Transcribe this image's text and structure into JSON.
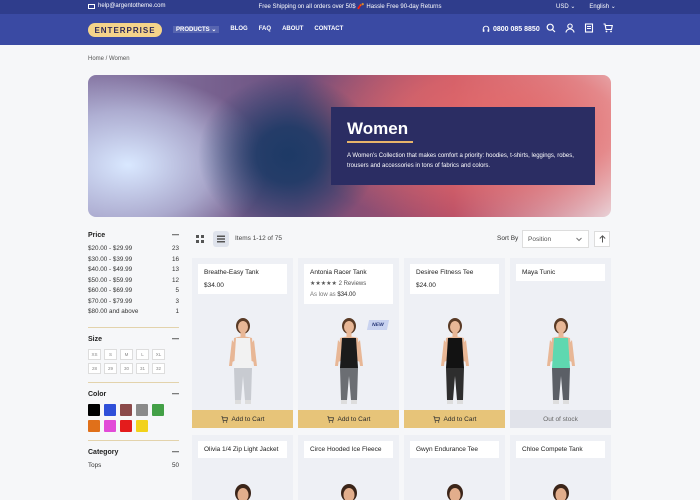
{
  "topbar": {
    "email": "help@argentotheme.com",
    "promo": "Free Shipping on all orders over 50$ 🧨 Hassle Free 90-day Returns",
    "currency": "USD ⌄",
    "language": "English ⌄"
  },
  "header": {
    "logo": "ENTERPRISE",
    "nav": [
      "PRODUCTS ⌄",
      "BLOG",
      "FAQ",
      "ABOUT",
      "CONTACT"
    ],
    "phone": "0800 085 8850"
  },
  "breadcrumb": "Home /  Women",
  "hero": {
    "title": "Women",
    "description": "A Women’s Collection that makes comfort a priority: hoodies, t-shirts, leggings, robes, trousers and accessories in tons of fabrics and colors."
  },
  "sidebar": {
    "price_title": "Price",
    "prices": [
      {
        "label": "$20.00 - $29.99",
        "count": "23"
      },
      {
        "label": "$30.00 - $39.99",
        "count": "16"
      },
      {
        "label": "$40.00 - $49.99",
        "count": "13"
      },
      {
        "label": "$50.00 - $59.99",
        "count": "12"
      },
      {
        "label": "$60.00 - $69.99",
        "count": "5"
      },
      {
        "label": "$70.00 - $79.99",
        "count": "3"
      },
      {
        "label": "$80.00 and above",
        "count": "1"
      }
    ],
    "size_title": "Size",
    "sizes": [
      "XS",
      "S",
      "M",
      "L",
      "XL",
      "28",
      "29",
      "30",
      "31",
      "32"
    ],
    "color_title": "Color",
    "colors": [
      "#000000",
      "#2f4fd8",
      "#8b4a4a",
      "#8a8a8a",
      "#43a047",
      "#e0701a",
      "#e24ad8",
      "#e41c1c",
      "#f2d21b"
    ],
    "category_title": "Category",
    "categories": [
      {
        "label": "Tops",
        "count": "50"
      }
    ],
    "collapse_symbol": "—"
  },
  "toolbar": {
    "items_text": "Items 1-12 of 75",
    "sort_by": "Sort By",
    "sort_value": "Position"
  },
  "products": [
    {
      "name": "Breathe-Easy Tank",
      "price": "$34.00",
      "button": "Add to Cart",
      "shirt": "#f2f2f2",
      "pants": "#c8cbd1"
    },
    {
      "name": "Antonia Racer Tank",
      "stars": "★★★★★",
      "reviews": "2  Reviews",
      "as_low_as": "As low as",
      "price": "$34.00",
      "badge": "NEW",
      "button": "Add to Cart",
      "shirt": "#1b1b1b",
      "pants": "#6b6e73"
    },
    {
      "name": "Desiree Fitness Tee",
      "price": "$24.00",
      "button": "Add to Cart",
      "shirt": "#121212",
      "pants": "#2e2e2e"
    },
    {
      "name": "Maya Tunic",
      "button": "Out of stock",
      "shirt": "#5fd8b0",
      "pants": "#5b5f66"
    },
    {
      "name": "Olivia 1/4 Zip Light Jacket"
    },
    {
      "name": "Circe Hooded Ice Fleece"
    },
    {
      "name": "Gwyn Endurance Tee"
    },
    {
      "name": "Chloe Compete Tank"
    }
  ]
}
